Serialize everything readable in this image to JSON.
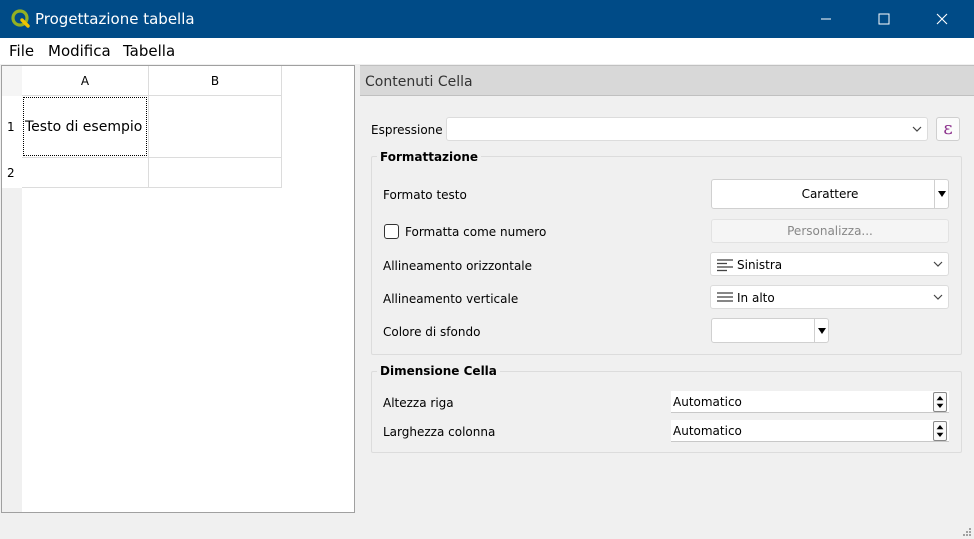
{
  "window": {
    "title": "Progettazione tabella"
  },
  "menu": {
    "file": "File",
    "modifica": "Modifica",
    "tabella": "Tabella"
  },
  "table": {
    "columns": [
      "A",
      "B"
    ],
    "rows": [
      "1",
      "2"
    ],
    "cells": {
      "a1": "Testo di esempio",
      "b1": "",
      "a2": "",
      "b2": ""
    }
  },
  "panel": {
    "title": "Contenuti Cella",
    "expression_label": "Espressione",
    "expression_value": "",
    "expression_button_symbol": "ε",
    "formatting": {
      "title": "Formattazione",
      "text_format_label": "Formato testo",
      "font_button": "Carattere",
      "format_as_number_label": "Formatta come numero",
      "format_as_number_checked": false,
      "customize_button": "Personalizza...",
      "h_align_label": "Allineamento orizzontale",
      "h_align_value": "Sinistra",
      "v_align_label": "Allineamento verticale",
      "v_align_value": "In alto",
      "bg_color_label": "Colore di sfondo",
      "bg_color": "#ffffff"
    },
    "cell_size": {
      "title": "Dimensione Cella",
      "row_height_label": "Altezza riga",
      "row_height_value": "Automatico",
      "col_width_label": "Larghezza colonna",
      "col_width_value": "Automatico"
    }
  },
  "colors": {
    "titlebar": "#004b87",
    "expression_icon": "#8b2f8b"
  },
  "icons": {
    "app": "qgis-icon",
    "minimize": "minimize-icon",
    "maximize": "maximize-icon",
    "close": "close-icon",
    "dropdown": "chevron-down-icon",
    "h_align": "align-left-icon",
    "v_align": "align-top-icon",
    "spin": "spin-arrows-icon"
  }
}
